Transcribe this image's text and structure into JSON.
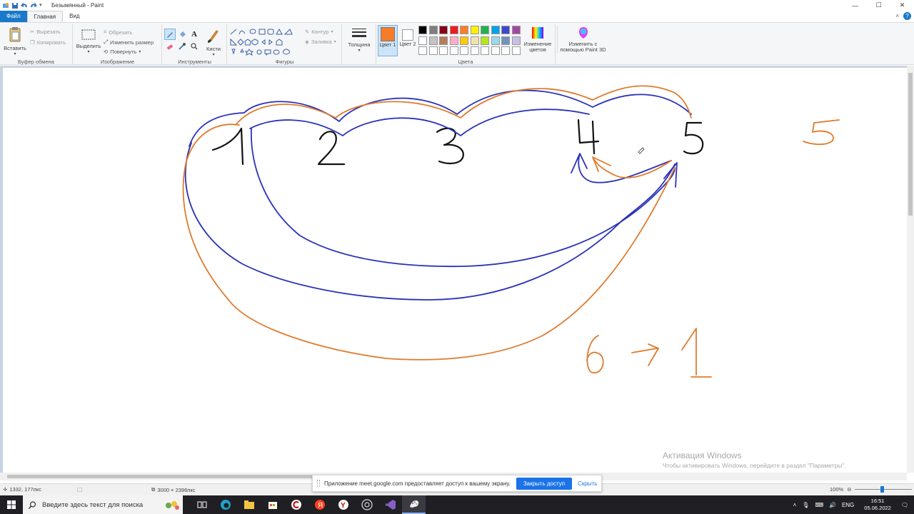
{
  "window": {
    "title": "Безымянный - Paint"
  },
  "menu": {
    "tabs": [
      "Файл",
      "Главная",
      "Вид"
    ]
  },
  "ribbon": {
    "clipboard": {
      "paste_label": "Вставить",
      "cut_label": "Вырезать",
      "copy_label": "Копировать",
      "group_label": "Буфер обмена"
    },
    "image": {
      "select_label": "Выделить",
      "crop_label": "Обрезать",
      "resize_label": "Изменить размер",
      "rotate_label": "Повернуть",
      "group_label": "Изображение"
    },
    "tools": {
      "group_label": "Инструменты",
      "brushes_label": "Кисти"
    },
    "shapes": {
      "outline_label": "Контур",
      "fill_label": "Заливка",
      "group_label": "Фигуры"
    },
    "thickness_label": "Толщина",
    "colors": {
      "color1_label": "Цвет 1",
      "color2_label": "Цвет 2",
      "color1_value": "#f57c28",
      "color2_value": "#ffffff",
      "edit_label": "Изменение цветов",
      "group_label": "Цвета",
      "palette": [
        "#000000",
        "#7f7f7f",
        "#880015",
        "#ed1c24",
        "#ff7f27",
        "#fff200",
        "#22b14c",
        "#00a2e8",
        "#3f48cc",
        "#a349a4",
        "#ffffff",
        "#c3c3c3",
        "#b97a57",
        "#ffaec9",
        "#ffc90e",
        "#efe4b0",
        "#b5e61d",
        "#99d9ea",
        "#7092be",
        "#c8bfe7",
        "#ffffff",
        "#ffffff",
        "#ffffff",
        "#ffffff",
        "#ffffff",
        "#ffffff",
        "#ffffff",
        "#ffffff",
        "#ffffff",
        "#ffffff"
      ]
    },
    "paint3d_label": "Изменить с помощью Paint 3D"
  },
  "canvas": {
    "drawn_labels": [
      "1",
      "2",
      "3",
      "4",
      "5",
      "5",
      "6",
      "1"
    ],
    "stroke_colors": {
      "black": "#111111",
      "blue": "#2a32b8",
      "orange": "#e07b2e"
    }
  },
  "watermark": {
    "title": "Активация Windows",
    "subtitle": "Чтобы активировать Windows, перейдите в раздел \"Параметры\"."
  },
  "share_banner": {
    "text": "Приложение meet.google.com предоставляет доступ к вашему экрану.",
    "stop_label": "Закрыть доступ",
    "hide_label": "Скрыть"
  },
  "status": {
    "cursor_pos": "1332, 177пкс",
    "canvas_size": "3000 × 2396пкс",
    "zoom": "100%"
  },
  "taskbar": {
    "search_placeholder": "Введите здесь текст для поиска",
    "lang": "ENG",
    "time": "16:51",
    "date": "05.06.2022"
  }
}
